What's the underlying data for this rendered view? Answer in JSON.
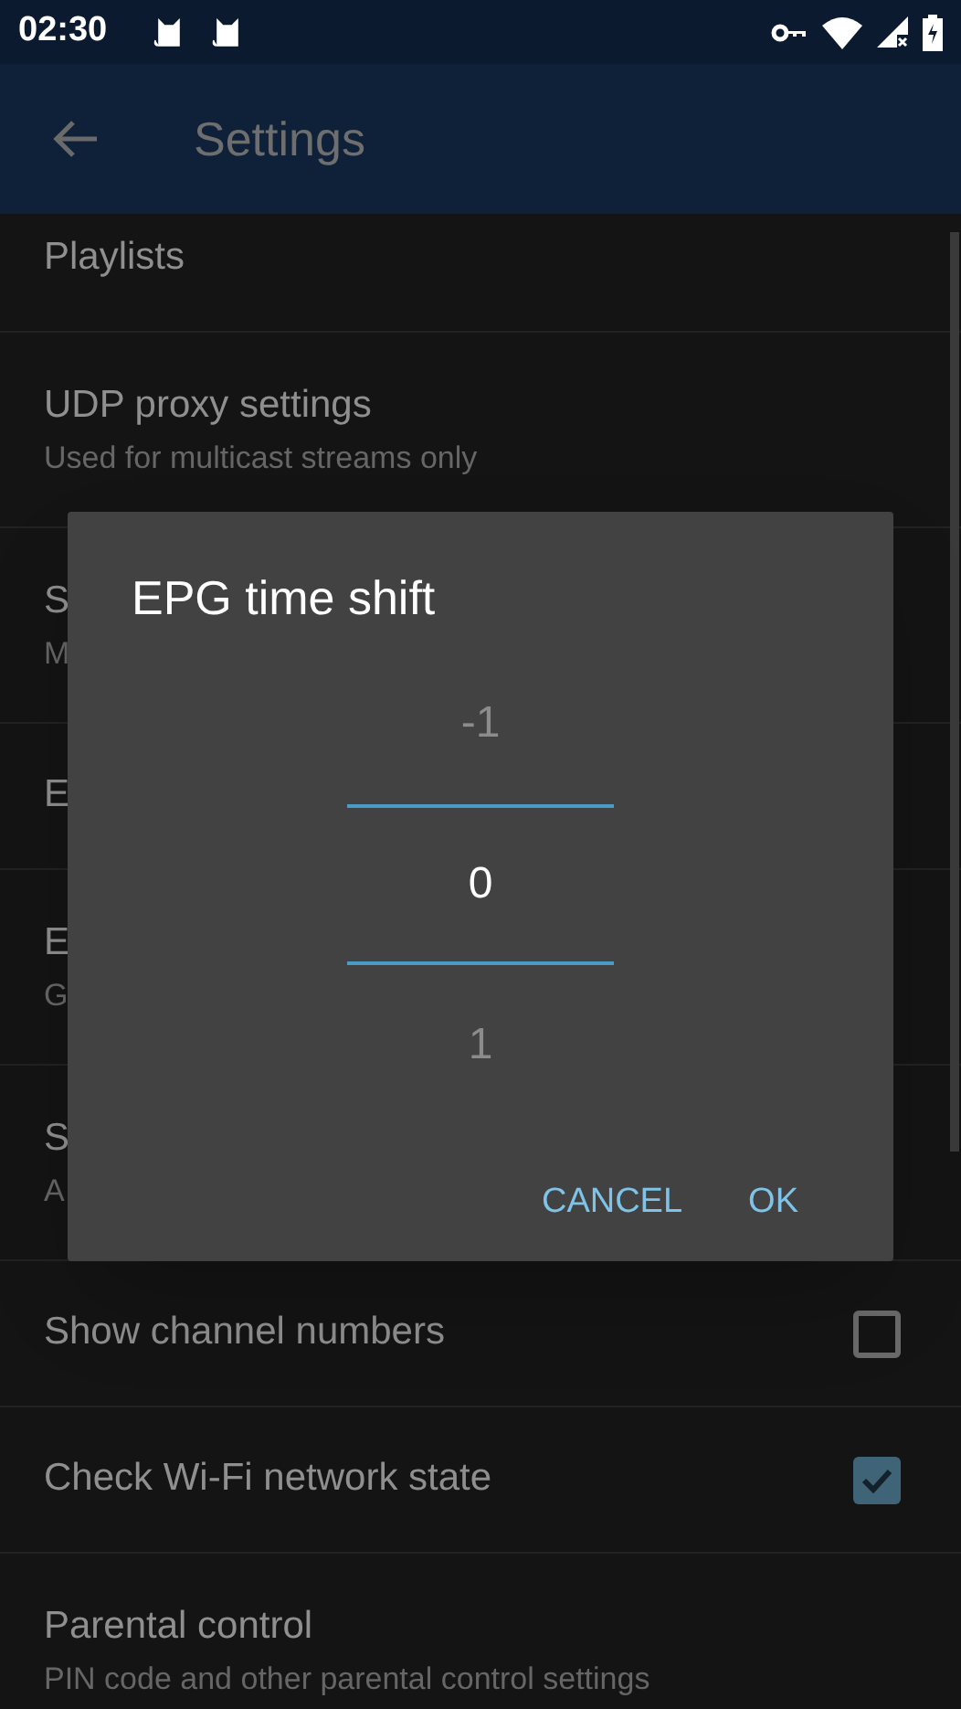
{
  "status_bar": {
    "time": "02:30"
  },
  "app_bar": {
    "title": "Settings"
  },
  "settings": [
    {
      "kind": "text",
      "title": "Playlists"
    },
    {
      "kind": "text",
      "title": "UDP proxy settings",
      "subtitle": "Used for multicast streams only"
    },
    {
      "kind": "text",
      "title": "S",
      "subtitle": "M"
    },
    {
      "kind": "text",
      "title": "E"
    },
    {
      "kind": "text",
      "title": "E",
      "subtitle": "G"
    },
    {
      "kind": "text",
      "title": "S",
      "subtitle": "A"
    },
    {
      "kind": "checkbox",
      "title": "Show channel numbers",
      "checked": false
    },
    {
      "kind": "checkbox",
      "title": "Check Wi-Fi network state",
      "checked": true
    },
    {
      "kind": "text",
      "title": "Parental control",
      "subtitle": "PIN code and other parental control settings"
    }
  ],
  "dialog": {
    "title": "EPG time shift",
    "picker": [
      {
        "label": "-1",
        "selected": false
      },
      {
        "label": "0",
        "selected": true
      },
      {
        "label": "1",
        "selected": false
      }
    ],
    "buttons": [
      "CANCEL",
      "OK"
    ]
  }
}
